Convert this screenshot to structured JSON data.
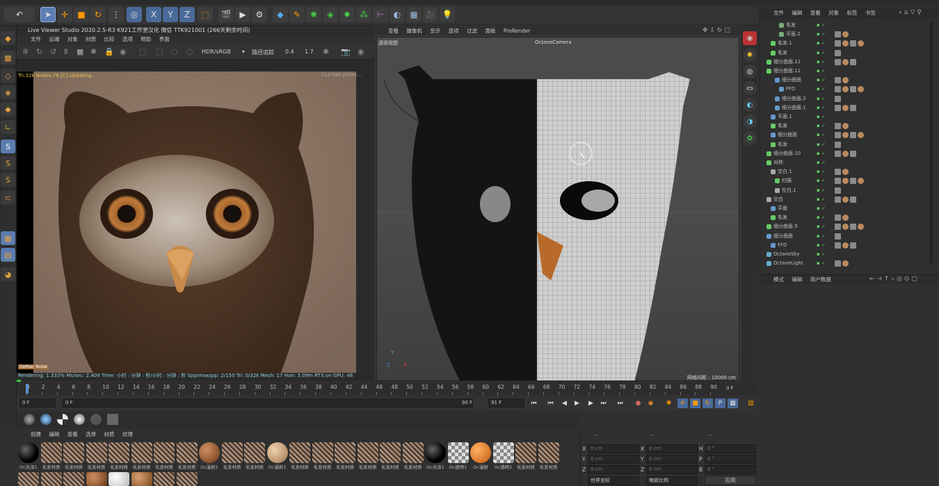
{
  "left_viewer": {
    "title": "Live Viewer Studio 2020.2.5-R3  K921工作室汉化 微信 TTK921001  (266天剩余时间)",
    "menu": [
      "文件",
      "云端",
      "对象",
      "材质",
      "比较",
      "选项",
      "帮助",
      "界面"
    ],
    "color_space": "HDR/sRGB",
    "mode": "路径追踪",
    "value_a": "0.4",
    "value_b": "1.7",
    "overlay_text": "Tri:32k Nodes:78 [C] Updating..",
    "corner_text": "512*480 ZOOM:...",
    "watermark": "DeMair Noise",
    "status": "Rendering: 1.333%  Ms/sec: 2.409    Time: 小时 : 分钟 : 秒/小时 : 分钟 : 秒   Spp/maxspp: 2/150    Tri: 0/32k    Mesh: 17    Hair: 3.09m    RTX:on    GPU:  48"
  },
  "viewport": {
    "menu": [
      "查看",
      "摄像机",
      "显示",
      "选项",
      "过滤",
      "面板",
      "ProRender"
    ],
    "label": "透视视图",
    "camera": "OctaneCamera",
    "grid_info": "网格间距 : 10000 cm",
    "axis_y": "Y",
    "axis_x": "X",
    "axis_z": "Z"
  },
  "object_manager": {
    "menu": [
      "文件",
      "编辑",
      "查看",
      "对象",
      "标签",
      "书签"
    ],
    "rows": [
      {
        "name": "毛发",
        "indent": 3,
        "color": "#7a7"
      },
      {
        "name": "平面.2",
        "indent": 3,
        "color": "#7a7"
      },
      {
        "name": "毛发.1",
        "indent": 1,
        "color": "#6c6"
      },
      {
        "name": "毛发",
        "indent": 1,
        "color": "#6c6"
      },
      {
        "name": "细分曲面.11",
        "indent": 0,
        "color": "#6c6"
      },
      {
        "name": "细分曲面.11",
        "indent": 0,
        "color": "#6c6"
      },
      {
        "name": "细分曲面",
        "indent": 2,
        "color": "#69c"
      },
      {
        "name": "FFD",
        "indent": 3,
        "color": "#69c"
      },
      {
        "name": "细分曲面.2",
        "indent": 2,
        "color": "#69c"
      },
      {
        "name": "细分曲面.1",
        "indent": 2,
        "color": "#69c"
      },
      {
        "name": "平面.1",
        "indent": 1,
        "color": "#69c"
      },
      {
        "name": "毛发",
        "indent": 1,
        "color": "#6c6"
      },
      {
        "name": "细分曲面",
        "indent": 1,
        "color": "#69c"
      },
      {
        "name": "毛发",
        "indent": 1,
        "color": "#6c6"
      },
      {
        "name": "细分曲面.10",
        "indent": 0,
        "color": "#6c6"
      },
      {
        "name": "对称",
        "indent": 0,
        "color": "#6c6"
      },
      {
        "name": "空白.1",
        "indent": 1,
        "color": "#aaa"
      },
      {
        "name": "扫描",
        "indent": 2,
        "color": "#6c6"
      },
      {
        "name": "空白.1",
        "indent": 2,
        "color": "#aaa"
      },
      {
        "name": "空白",
        "indent": 0,
        "color": "#aaa"
      },
      {
        "name": "平面",
        "indent": 1,
        "color": "#69c"
      },
      {
        "name": "毛发",
        "indent": 1,
        "color": "#6c6"
      },
      {
        "name": "细分曲面.5",
        "indent": 0,
        "color": "#6c6"
      },
      {
        "name": "细分曲面",
        "indent": 0,
        "color": "#69c"
      },
      {
        "name": "FFD",
        "indent": 1,
        "color": "#69c"
      },
      {
        "name": "OctaneSky",
        "indent": 0,
        "color": "#6ac"
      },
      {
        "name": "OctaneLight",
        "indent": 0,
        "color": "#6ac"
      }
    ]
  },
  "attributes": {
    "menu": [
      "模式",
      "编辑",
      "用户数据"
    ]
  },
  "timeline": {
    "ticks": [
      "0",
      "2",
      "4",
      "6",
      "8",
      "10",
      "12",
      "14",
      "16",
      "18",
      "20",
      "22",
      "24",
      "26",
      "28",
      "30",
      "32",
      "34",
      "36",
      "38",
      "40",
      "42",
      "44",
      "46",
      "48",
      "50",
      "52",
      "54",
      "56",
      "58",
      "60",
      "62",
      "64",
      "66",
      "68",
      "70",
      "72",
      "74",
      "76",
      "78",
      "80",
      "82",
      "84",
      "86",
      "88",
      "90"
    ],
    "frame_end": "0 F",
    "start_field": "0 F",
    "current_field": "0 F",
    "end_field": "90 F",
    "max_field": "91 F"
  },
  "materials": {
    "menu": [
      "创建",
      "编辑",
      "查看",
      "选择",
      "材质",
      "纹理"
    ],
    "items": [
      {
        "label": "Oc光泽1",
        "type": "black"
      },
      {
        "label": "毛发材质",
        "type": "hair"
      },
      {
        "label": "毛发材质",
        "type": "hair"
      },
      {
        "label": "毛发材质",
        "type": "hair"
      },
      {
        "label": "毛发材质",
        "type": "hair"
      },
      {
        "label": "毛发材质",
        "type": "hair"
      },
      {
        "label": "毛发材质",
        "type": "hair"
      },
      {
        "label": "毛发材质",
        "type": "hair"
      },
      {
        "label": "Oc漫射1",
        "type": "brown"
      },
      {
        "label": "毛发材质",
        "type": "hair"
      },
      {
        "label": "毛发材质",
        "type": "hair"
      },
      {
        "label": "Oc漫射1",
        "type": "tan"
      },
      {
        "label": "毛发材质",
        "type": "hair"
      },
      {
        "label": "毛发材质",
        "type": "hair"
      },
      {
        "label": "毛发材质",
        "type": "hair"
      },
      {
        "label": "毛发材质",
        "type": "hair"
      },
      {
        "label": "毛发材质",
        "type": "hair"
      },
      {
        "label": "毛发材质",
        "type": "hair"
      },
      {
        "label": "Oc光泽1",
        "type": "black"
      },
      {
        "label": "Oc透明1",
        "type": "checker"
      },
      {
        "label": "Oc漫射",
        "type": "orange"
      },
      {
        "label": "Oc透明1",
        "type": "checker"
      },
      {
        "label": "毛发材质",
        "type": "hair"
      },
      {
        "label": "毛发材质",
        "type": "hair"
      }
    ]
  },
  "coordinates": {
    "headers": [
      "--",
      "--",
      "--"
    ],
    "rows": [
      {
        "a": "X",
        "av": "0 cm",
        "b": "X",
        "bv": "0 cm",
        "c": "H",
        "cv": "0 °"
      },
      {
        "a": "Y",
        "av": "0 cm",
        "b": "Y",
        "bv": "0 cm",
        "c": "P",
        "cv": "0 °"
      },
      {
        "a": "Z",
        "av": "0 cm",
        "b": "Z",
        "bv": "0 cm",
        "c": "B",
        "cv": "0 °"
      }
    ],
    "world": "世界坐标",
    "scale": "缩放比例",
    "apply": "应用"
  }
}
